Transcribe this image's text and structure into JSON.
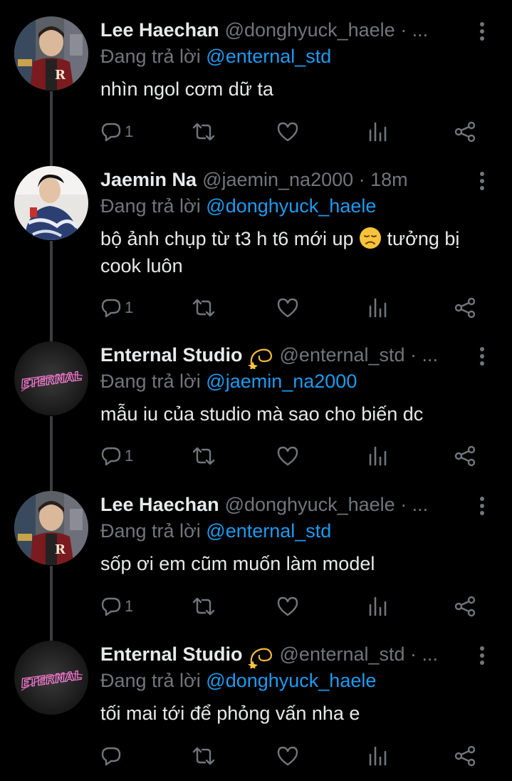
{
  "reply_prefix": "Đang trả lời",
  "tweets": [
    {
      "name": "Lee Haechan",
      "handle": "@donghyuck_haele",
      "meta": "· ...",
      "reply_to": "@enternal_std",
      "text": "nhìn ngol cơm dữ ta",
      "reply_count": "1",
      "avatar": "haechan"
    },
    {
      "name": "Jaemin Na",
      "handle": "@jaemin_na2000",
      "meta": "· 18m",
      "reply_to": "@donghyuck_haele",
      "text_before": "bộ ảnh chụp từ t3 h t6 mới up",
      "text_after": "tưởng bị cook luôn",
      "reply_count": "1",
      "avatar": "jaemin"
    },
    {
      "name": "Enternal Studio",
      "handle": "@enternal_std",
      "meta": "· ...",
      "reply_to": "@jaemin_na2000",
      "text": "mẫu iu của studio mà sao cho biến dc",
      "reply_count": "1",
      "avatar": "enternal"
    },
    {
      "name": "Lee Haechan",
      "handle": "@donghyuck_haele",
      "meta": "· ...",
      "reply_to": "@enternal_std",
      "text": "sốp ơi em cũm muốn làm model",
      "reply_count": "1",
      "avatar": "haechan"
    },
    {
      "name": "Enternal Studio",
      "handle": "@enternal_std",
      "meta": "· ...",
      "reply_to": "@donghyuck_haele",
      "text": "tối mai tới để phỏng vấn nha e",
      "reply_count": "",
      "avatar": "enternal"
    }
  ],
  "avatar_logo_text": "ETERNAL",
  "icons": {
    "reply": "speech-bubble-icon",
    "retweet": "retweet-arrows-icon",
    "like": "heart-outline-icon",
    "views": "bar-chart-icon",
    "share": "share-nodes-icon",
    "more": "vertical-dots-icon",
    "badge": "dizzy-star-emoji",
    "sad": "disappointed-face-emoji"
  },
  "colors": {
    "background": "#000000",
    "text_primary": "#e7e9ea",
    "text_secondary": "#71767b",
    "mention": "#1d9bf0",
    "thread_line": "#3a3d40"
  }
}
